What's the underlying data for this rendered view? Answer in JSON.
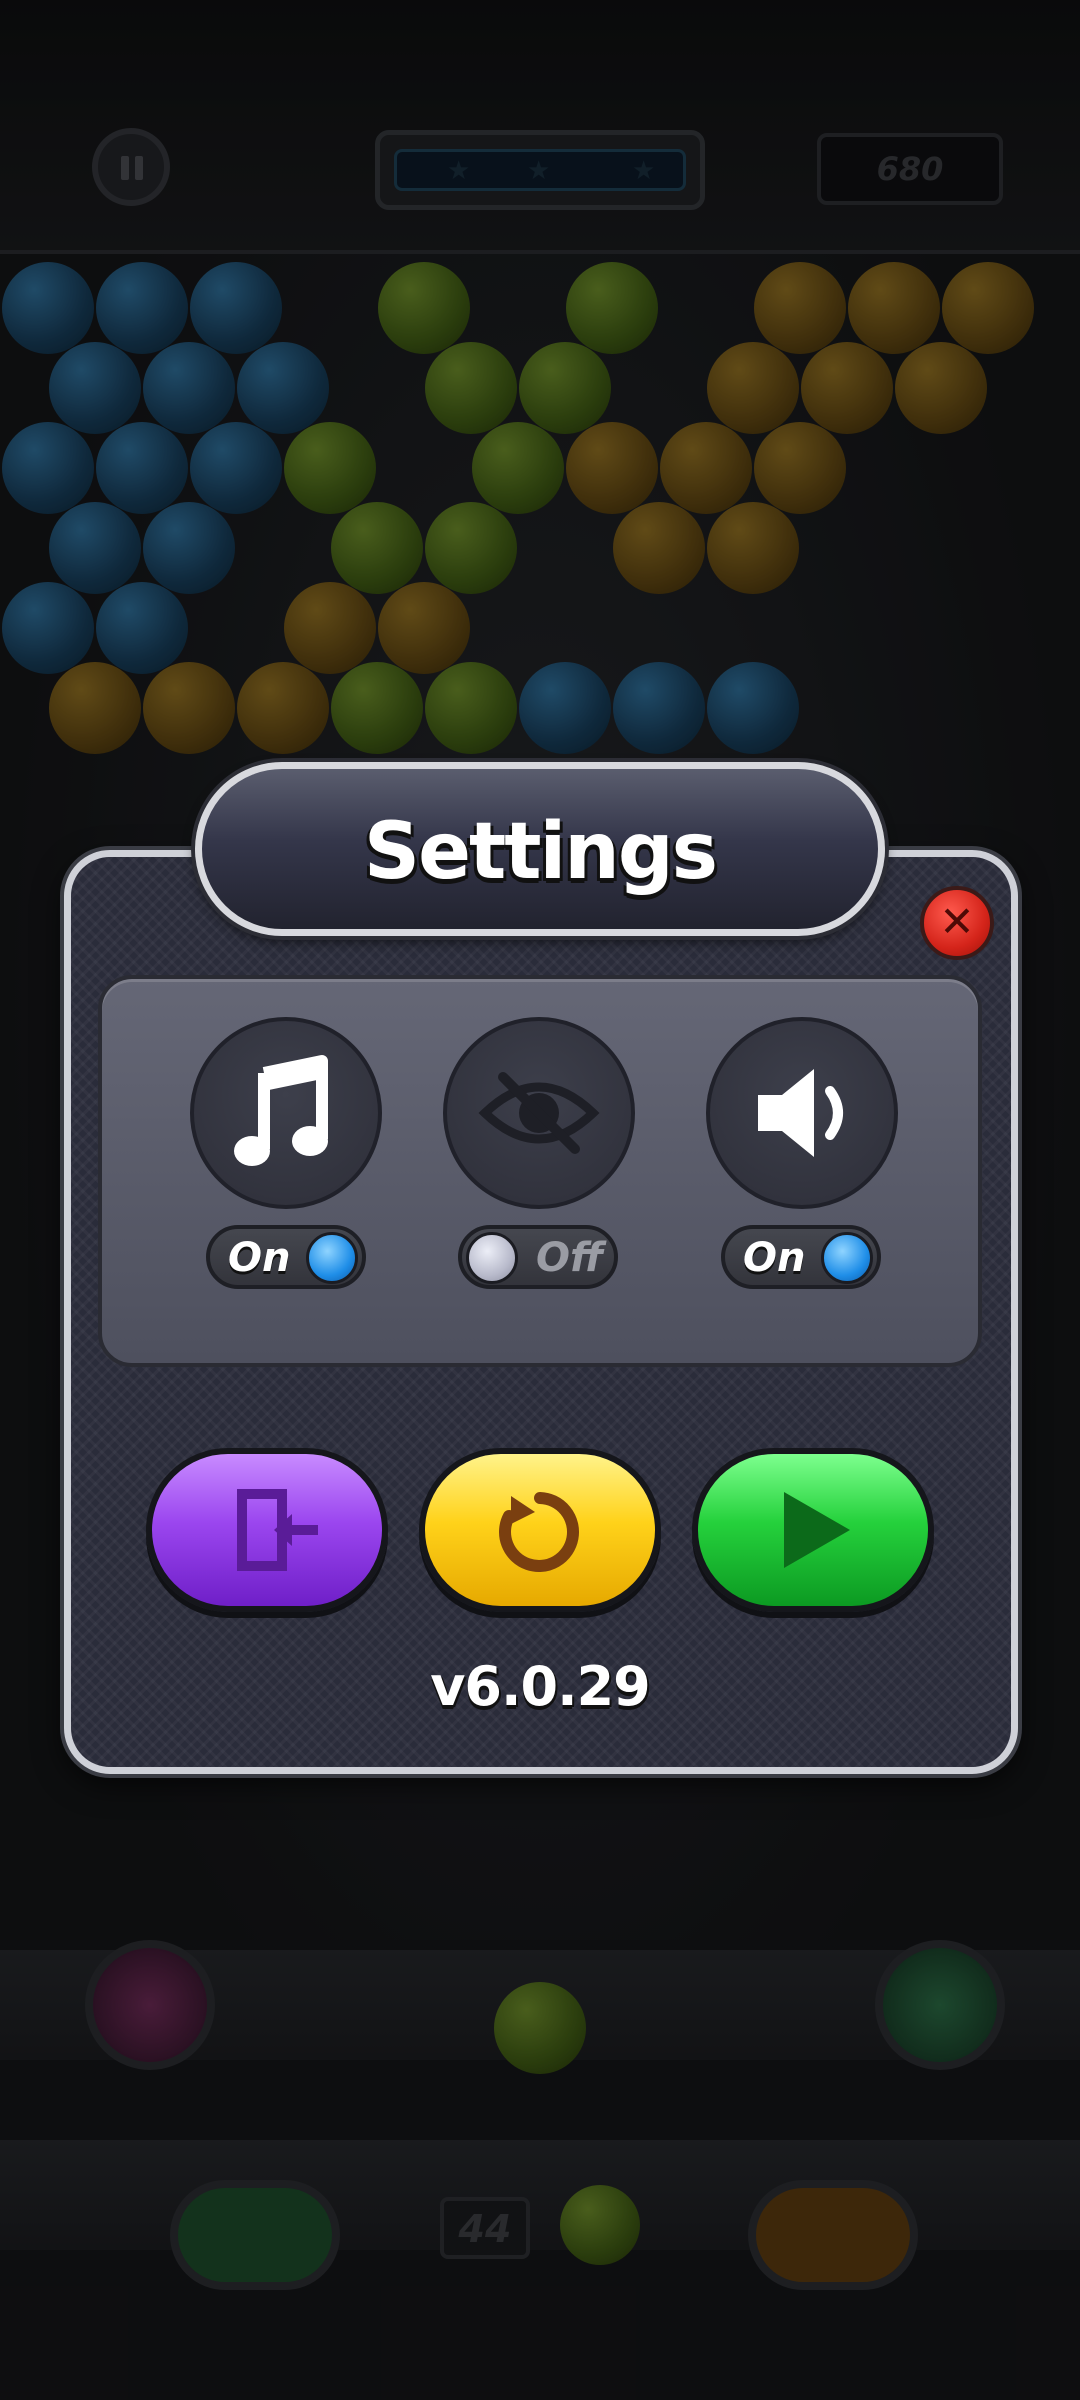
{
  "hud": {
    "score": "680",
    "pause_icon": "pause-icon",
    "progress_stars": 3
  },
  "bubble_field": {
    "rows": [
      [
        "blue",
        "blue",
        "blue",
        "",
        "green",
        "",
        "green",
        "",
        "yellow",
        "yellow",
        "yellow"
      ],
      [
        "blue",
        "blue",
        "blue",
        "",
        "green",
        "green",
        "",
        "yellow",
        "yellow",
        "yellow"
      ],
      [
        "blue",
        "blue",
        "blue",
        "green",
        "",
        "green",
        "yellow",
        "yellow",
        "yellow"
      ],
      [
        "blue",
        "blue",
        "",
        "green",
        "green",
        "",
        "yellow",
        "yellow"
      ],
      [
        "blue",
        "blue",
        "",
        "yellow",
        "yellow"
      ],
      [
        "yellow",
        "yellow",
        "yellow",
        "green",
        "green",
        "blue",
        "blue",
        "blue"
      ]
    ]
  },
  "dock": {
    "shots_left": "44"
  },
  "settings": {
    "title": "Settings",
    "close_icon": "close-icon",
    "options": [
      {
        "icon": "music-note-icon",
        "label": "On",
        "state": "on"
      },
      {
        "icon": "eye-slash-icon",
        "label": "Off",
        "state": "off"
      },
      {
        "icon": "speaker-icon",
        "label": "On",
        "state": "on"
      }
    ],
    "buttons": [
      {
        "icon": "exit-icon"
      },
      {
        "icon": "restart-icon"
      },
      {
        "icon": "play-icon"
      }
    ],
    "version": "v6.0.29"
  },
  "colors": {
    "music_toggle_knob": "#1f8ee8",
    "exit_button": "#9b46ef",
    "restart_button": "#ffd21a",
    "play_button": "#25d13c",
    "close_button": "#d4241a"
  }
}
